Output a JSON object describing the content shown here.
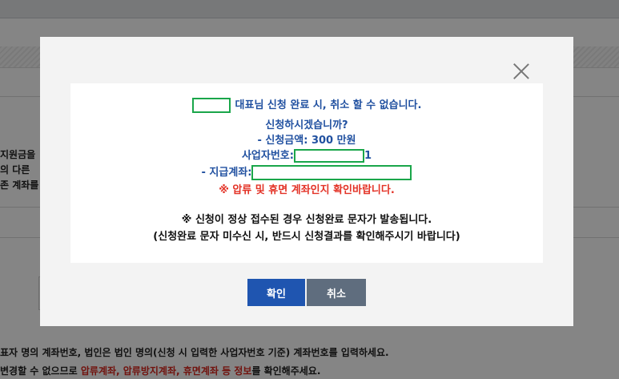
{
  "background": {
    "fragments": [
      "지원금을",
      "의 다른",
      "존 계좌를"
    ],
    "note1": "표자 명의 계좌번호, 법인은 법인 명의(신청 시 입력한 사업자번호 기준) 계좌번호를 입력하세요.",
    "note2_prefix": "변경할 수 없으므로 ",
    "note2_highlight": "압류계좌, 압류방지계좌, 휴면계좌 등 정보",
    "note2_suffix": "를 확인해주세요."
  },
  "modal": {
    "line1": "대표님 신청 완료 시, 취소 할 수 없습니다.",
    "line2": "신청하시겠습니까?",
    "line3": "- 신청금액: 300 만원",
    "line4_label": "사업자번호:",
    "line4_suffix": "1",
    "line5_label": "- 지급계좌:",
    "line6": "※ 압류 및 휴면 계좌인지 확인바랍니다.",
    "line7": "※ 신청이 정상 접수된 경우 신청완료 문자가 발송됩니다.",
    "line8": "(신청완료 문자 미수신 시, 반드시 신청결과를 확인해주시기 바랍니다)",
    "confirm_label": "확인",
    "cancel_label": "취소"
  },
  "colors": {
    "blue_text": "#2050a0",
    "red_text": "#e33226",
    "confirm_button": "#1f55b0",
    "cancel_button": "#5f6d7e",
    "mask_border": "#1aa64a"
  },
  "icons": {
    "close": "close-icon"
  }
}
